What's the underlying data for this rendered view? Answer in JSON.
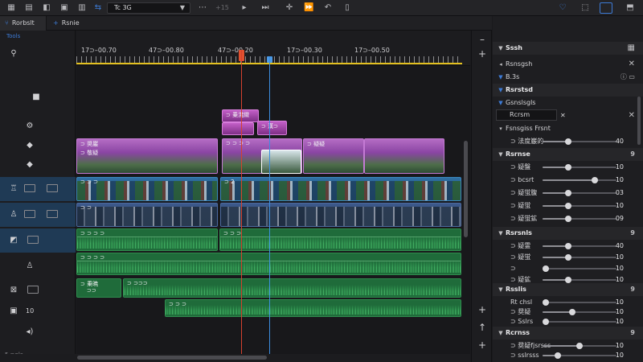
{
  "toolbar": {
    "timecode_select": "Tc 3G",
    "nudge_text": "+15",
    "icons": [
      "grid-icon",
      "folder-icon",
      "document-icon",
      "link-icon",
      "play-icon",
      "skip-icon",
      "move-icon",
      "forward-icon",
      "undo-icon",
      "clipboard-icon",
      "heart-icon",
      "crop-icon",
      "layout-icon",
      "export-icon"
    ]
  },
  "tabs": [
    {
      "label": "Rorbslt",
      "icon": "branch-icon"
    },
    {
      "label": "Rsnie",
      "icon": "plus-icon"
    }
  ],
  "headers": {
    "panel_label": "Tools",
    "rows": [
      {
        "icon": "pin-icon"
      },
      {
        "icon": "gear-icon"
      },
      {
        "icon": "diamond-icon"
      },
      {
        "icon": "diamond-icon"
      },
      {
        "icon": "video-track-icon"
      },
      {
        "icon": "video-track-icon"
      },
      {
        "icon": "audio-track-icon"
      },
      {
        "icon": "person-icon"
      },
      {
        "icon": "clip-icon"
      },
      {
        "icon": "clip-icon",
        "level": "10"
      },
      {
        "icon": "speaker-icon"
      }
    ],
    "footer": "5 ⊃ola"
  },
  "ruler": {
    "timecodes": [
      "17⊃–00.70",
      "47⊃–00.80",
      "47⊃–00.20",
      "17⊃–00.30",
      "17⊃–00.50"
    ]
  },
  "clips": {
    "pink1": "⊃ 乗溌緻",
    "pink2": "⊃ 漢⊃",
    "purple1": "⊃ 奨巖",
    "purple1_sub": "⊃ 敬疑",
    "purple2": "⊃ ⊃ ⊃ ⊃",
    "purple3": "⊃ 疑疑",
    "blue1": "⊃ ⊃ ⊃",
    "blue2": "⊃ 2",
    "slate1": "⊃ ⊃",
    "green1": "⊃ ⊃ ⊃ ⊃",
    "green2": "⊃ ⊃ ⊃",
    "green3": "⊃ ⊃ ⊃ ⊃",
    "green4": "⊃ 乗暁",
    "green4_sub": "⊃⊃",
    "green5": "⊃ ⊃⊃⊃",
    "green6": "⊃ ⊃ ⊃"
  },
  "inspector": {
    "title": "Sssh",
    "breadcrumb": "Rsnsgsh",
    "row_a": "B.3s",
    "sec_1": "Rsrstsd",
    "sec_2": "Gsnslsgls",
    "field": "Rcrsm",
    "sec_3": "Fsnsgiss Frsnt",
    "row_b": {
      "label": "⊃ 法度巌的",
      "value": "40"
    },
    "sec_4": {
      "label": "Rsrnse",
      "right": "9"
    },
    "params_1": [
      {
        "label": "⊃ 疑盤",
        "value": "10",
        "fill": 0.34
      },
      {
        "label": "⊃ bcsrt",
        "value": "10",
        "fill": 0.7
      },
      {
        "label": "⊃ 疑蛍腹",
        "value": "03",
        "fill": 0.34
      },
      {
        "label": "⊃ 疑蛍",
        "value": "10",
        "fill": 0.34
      },
      {
        "label": "⊃ 疑蛍鉱",
        "value": "09",
        "fill": 0.34
      }
    ],
    "sec_5": {
      "label": "Rsrsnls",
      "right": "9"
    },
    "params_2": [
      {
        "label": "⊃ 疑霊",
        "value": "40",
        "fill": 0.34
      },
      {
        "label": "⊃ 疑蛍",
        "value": "10",
        "fill": 0.34
      },
      {
        "label": "⊃",
        "value": "10",
        "fill": 0.0
      },
      {
        "label": "⊃ 疑鉱",
        "value": "10",
        "fill": 0.34
      }
    ],
    "sec_6": {
      "label": "Rsslis",
      "right": "9"
    },
    "params_3": [
      {
        "label": "Rt chsl",
        "value": "10",
        "fill": 0.0
      },
      {
        "label": "⊃ 奨疑",
        "value": "10",
        "fill": 0.4
      },
      {
        "label": "⊃ Sslrs",
        "value": "10",
        "fill": 0.0
      }
    ],
    "sec_7": {
      "label": "Rcrnss",
      "right": "9"
    },
    "params_4": [
      {
        "label": "⊃ 奨疑fjsrsss",
        "value": "10",
        "fill": 0.5
      },
      {
        "label": "⊃ sslrsss",
        "value": "10",
        "fill": 0.2
      }
    ]
  },
  "colors": {
    "accent": "#3d7bd6",
    "playhead": "#d6412e",
    "purple_clip": "#8a45a3",
    "blue_clip": "#1c4f7c",
    "audio_clip": "#1f6b3a"
  }
}
